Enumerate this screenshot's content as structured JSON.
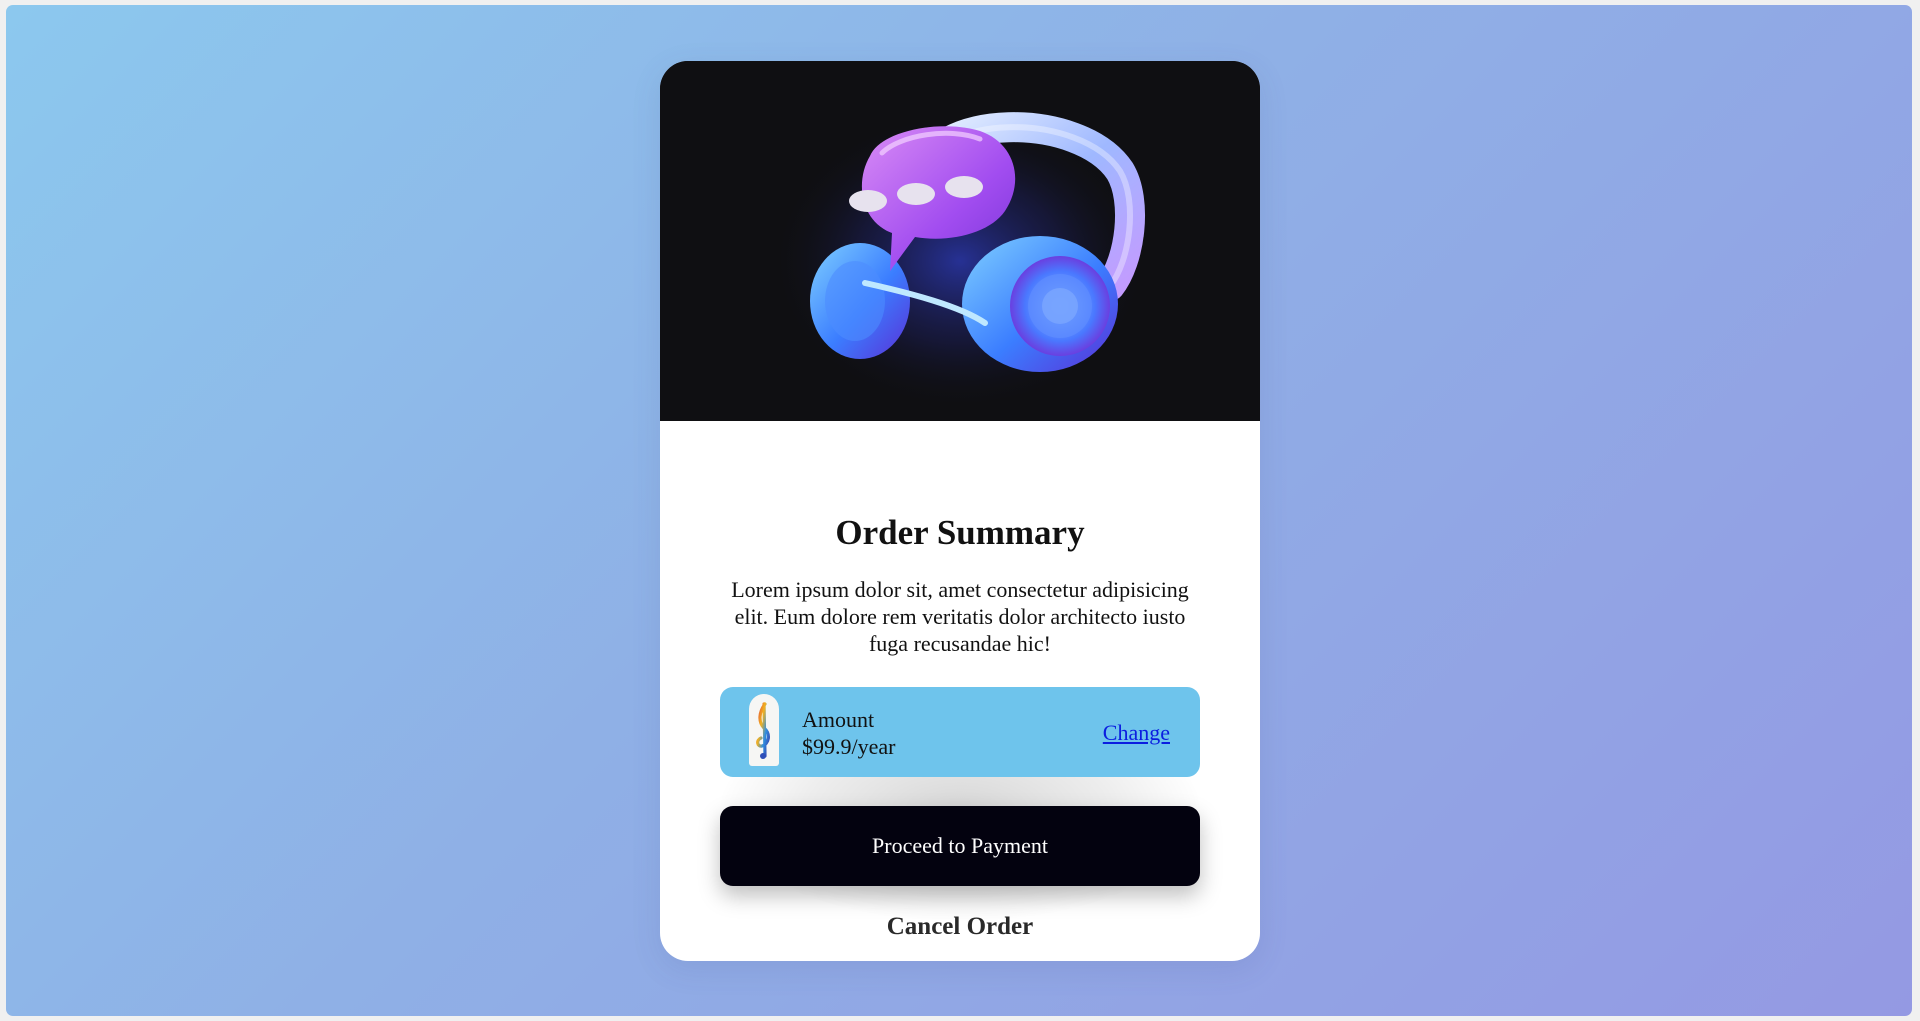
{
  "order": {
    "title": "Order Summary",
    "description": "Lorem ipsum dolor sit, amet consectetur adipisicing elit. Eum dolore rem veritatis dolor architecto iusto fuga recusandae hic!",
    "amount_label": "Amount",
    "amount_value": "$99.9/year",
    "change_link": "Change",
    "pay_button": "Proceed to Payment",
    "cancel_button": "Cancel Order"
  },
  "hero": {
    "image": "headphones-chat-bubble-illustration",
    "background": "#0f0f12"
  },
  "icons": {
    "amount_icon": "music-note-icon"
  },
  "colors": {
    "page_gradient_start": "#8cc8ee",
    "page_gradient_end": "#9499e3",
    "amount_box": "#6ec4ec",
    "pay_button": "#03020f",
    "link": "#0b1ee0"
  }
}
